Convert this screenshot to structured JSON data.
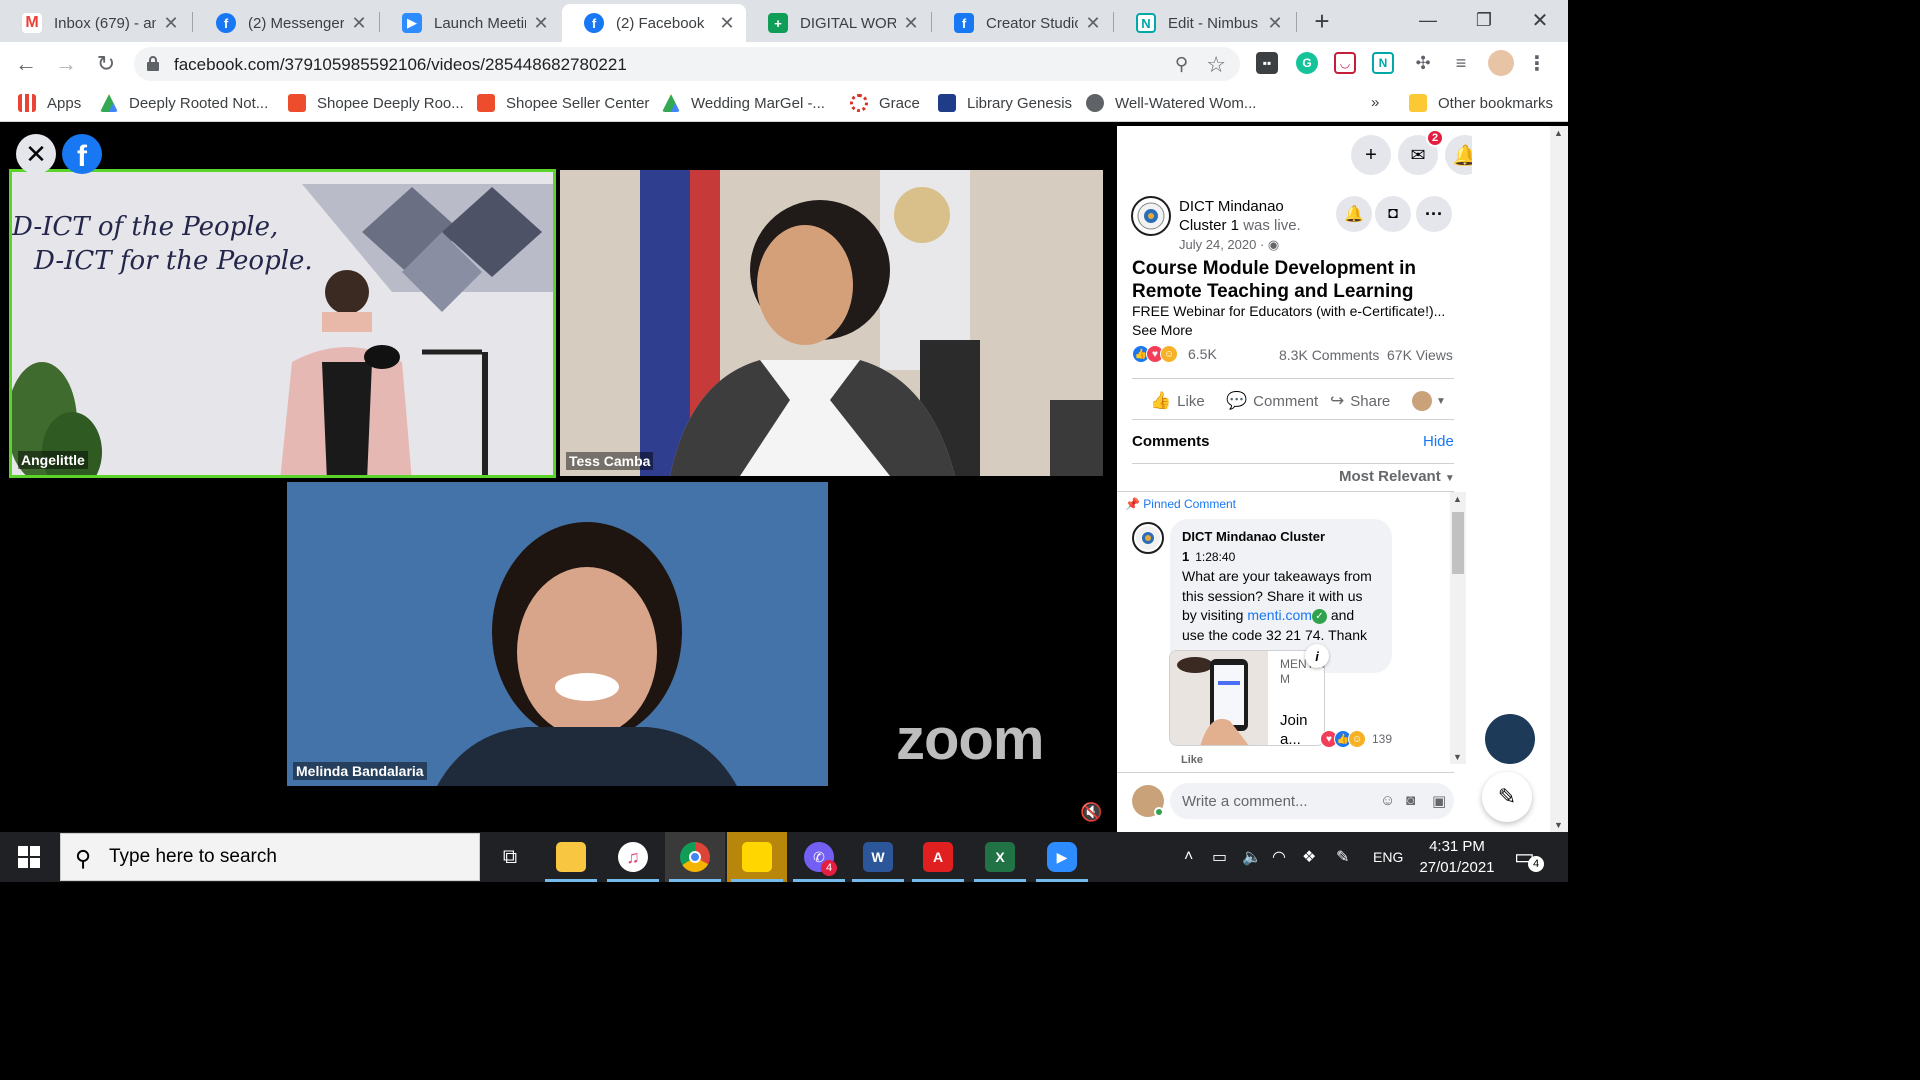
{
  "tabs": [
    {
      "title": "Inbox (679) - an",
      "favicon": "gmail-icon",
      "color": "#ea4335"
    },
    {
      "title": "(2) Messenger |",
      "favicon": "facebook-icon",
      "color": "#1877f2"
    },
    {
      "title": "Launch Meeting",
      "favicon": "zoom-icon",
      "color": "#2d8cff"
    },
    {
      "title": "(2) Facebook",
      "favicon": "facebook-icon",
      "color": "#1877f2"
    },
    {
      "title": "DIGITAL WORKF",
      "favicon": "sheets-icon",
      "color": "#0f9d58"
    },
    {
      "title": "Creator Studio",
      "favicon": "facebook-icon",
      "color": "#1877f2"
    },
    {
      "title": "Edit - Nimbus S",
      "favicon": "nimbus-icon",
      "color": "#00a8a8"
    }
  ],
  "address_bar": {
    "url": "facebook.com/379105985592106/videos/285448682780221"
  },
  "bookmarks": [
    {
      "label": "Apps"
    },
    {
      "label": "Deeply Rooted Not..."
    },
    {
      "label": "Shopee Deeply Roo..."
    },
    {
      "label": "Shopee Seller Center"
    },
    {
      "label": "Wedding MarGel -..."
    },
    {
      "label": "Grace"
    },
    {
      "label": "Library Genesis"
    },
    {
      "label": "Well-Watered Wom..."
    }
  ],
  "bookmarks_overflow": "»",
  "other_bookmarks": "Other bookmarks",
  "video": {
    "participants": [
      {
        "name": "Angelittle",
        "banner_line1": "D-ICT of the People,",
        "banner_line2": "D-ICT for the People."
      },
      {
        "name": "Tess Camba"
      },
      {
        "name": "Melinda Bandalaria"
      }
    ],
    "watermark": "zoom"
  },
  "fb": {
    "messenger_badge": "2",
    "page_name": "DICT Mindanao Cluster 1",
    "was_live": "was live.",
    "date": "July 24, 2020 · ",
    "title": "Course Module Development in Remote Teaching and Learning",
    "description": "FREE Webinar for Educators (with e-Certificate!)...",
    "see_more": "See More",
    "reaction_count": "6.5K",
    "comments_count": "8.3K Comments",
    "views_count": "67K Views",
    "actions": {
      "like": "Like",
      "comment": "Comment",
      "share": "Share"
    },
    "comments_header": "Comments",
    "hide": "Hide",
    "sort": "Most Relevant",
    "pinned_label": "Pinned Comment",
    "pinned_comment": {
      "author": "DICT Mindanao Cluster 1",
      "time": "1:28:40",
      "text_before_link": "What are your takeaways from this session? Share it with us by visiting ",
      "link": "menti.com",
      "text_after_link": " and use the code 32 21 74. Thank you.",
      "preview_site": "MENTI.CO M",
      "preview_title": "Join a...",
      "reaction_count": "139",
      "like": "Like"
    },
    "write_placeholder": "Write a comment..."
  },
  "taskbar": {
    "search_placeholder": "Type here to search",
    "viber_badge": "4",
    "lang": "ENG",
    "time": "4:31 PM",
    "date": "27/01/2021",
    "notif_count": "4"
  },
  "colors": {
    "fb_blue": "#1877f2",
    "zoom_active_border": "#5bd42a",
    "taskbar": "#202124"
  }
}
